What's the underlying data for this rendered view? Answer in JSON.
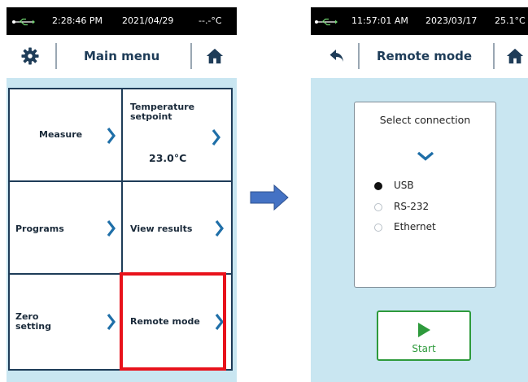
{
  "left_screen": {
    "status": {
      "time": "2:28:46 PM",
      "date": "2021/04/29",
      "temperature": "--.-°C"
    },
    "title": "Main menu",
    "icons": {
      "settings": "gear-icon",
      "home": "home-icon",
      "usb": "usb-icon"
    },
    "tiles": [
      {
        "label": "Measure"
      },
      {
        "label": "Temperature setpoint",
        "value": "23.0°C"
      },
      {
        "label": "Programs"
      },
      {
        "label": "View results"
      },
      {
        "label": "Zero setting"
      },
      {
        "label": "Remote mode"
      }
    ],
    "highlighted_tile": "Remote mode",
    "highlight_color": "#e8121b"
  },
  "transition_arrow": {
    "icon": "right-arrow-icon",
    "color": "#4472c4"
  },
  "right_screen": {
    "status": {
      "time": "11:57:01 AM",
      "date": "2023/03/17",
      "temperature": "25.1°C"
    },
    "title": "Remote mode",
    "icons": {
      "back": "back-arrow-icon",
      "home": "home-icon",
      "dropdown": "chevron-down-icon",
      "start": "play-icon"
    },
    "connection": {
      "heading": "Select connection",
      "options": [
        {
          "label": "USB",
          "selected": true
        },
        {
          "label": "RS-232",
          "selected": false
        },
        {
          "label": "Ethernet",
          "selected": false
        }
      ]
    },
    "start_label": "Start",
    "accent_color": "#2e9a3c"
  },
  "colors": {
    "panel_bg": "#c9e6f1",
    "navy": "#1e3c58",
    "chevron": "#1f6fa8"
  }
}
